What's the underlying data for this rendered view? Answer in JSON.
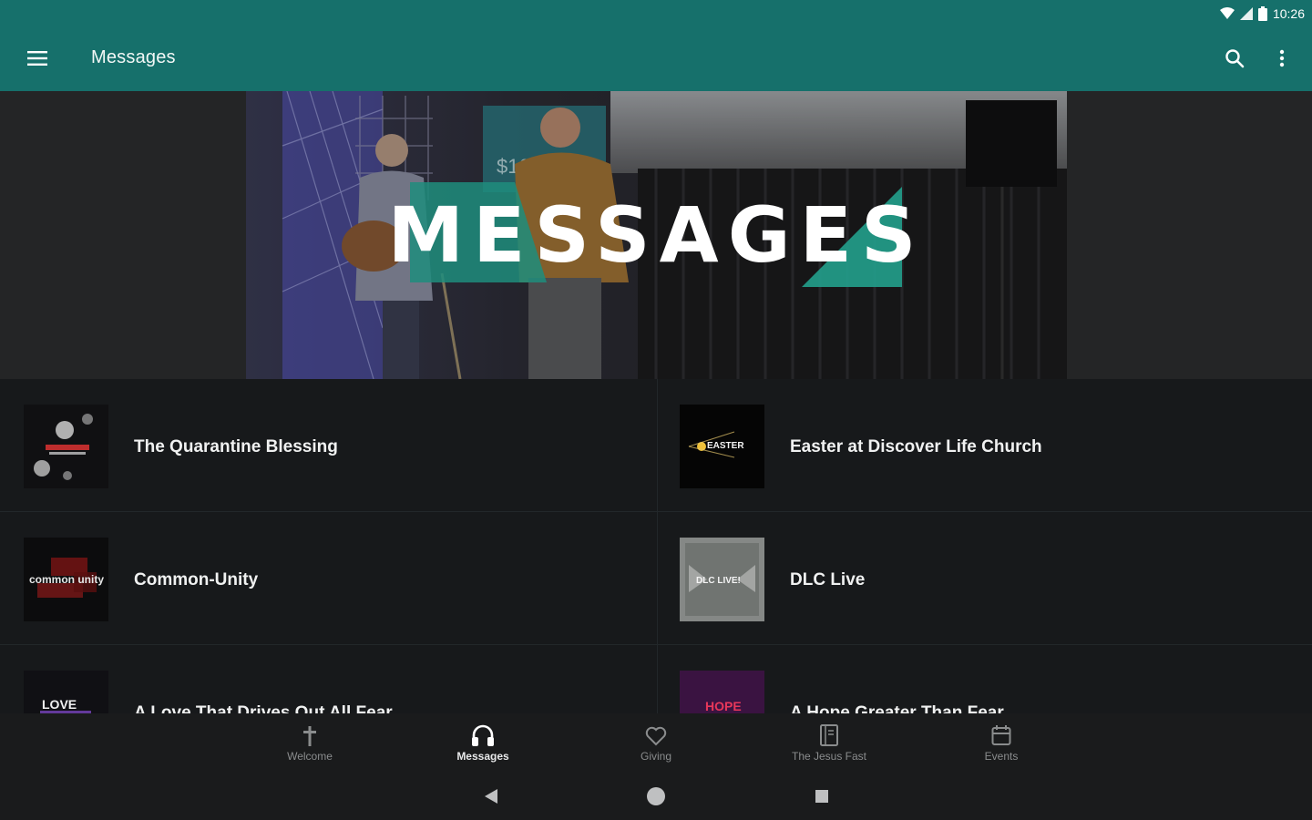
{
  "status_bar": {
    "time": "10:26"
  },
  "toolbar": {
    "title": "Messages"
  },
  "hero": {
    "title": "MESSAGES"
  },
  "series": [
    {
      "title": "The Quarantine Blessing"
    },
    {
      "title": "Easter at Discover Life Church",
      "thumb_text": "EASTER"
    },
    {
      "title": "Common-Unity",
      "thumb_text": "common unity"
    },
    {
      "title": "DLC Live",
      "thumb_text": "DLC LIVE!"
    },
    {
      "title": "A Love That Drives Out All Fear",
      "thumb_text": "LOVE"
    },
    {
      "title": "A Hope Greater Than Fear",
      "thumb_text": "HOPE"
    }
  ],
  "bottom_nav": [
    {
      "label": "Welcome",
      "icon": "cross-icon"
    },
    {
      "label": "Messages",
      "icon": "headphones-icon",
      "active": true
    },
    {
      "label": "Giving",
      "icon": "heart-icon"
    },
    {
      "label": "The Jesus Fast",
      "icon": "book-icon"
    },
    {
      "label": "Events",
      "icon": "calendar-icon"
    }
  ],
  "colors": {
    "toolbar": "#16706b",
    "background": "#17191b",
    "accent": "#2a9d8f"
  }
}
